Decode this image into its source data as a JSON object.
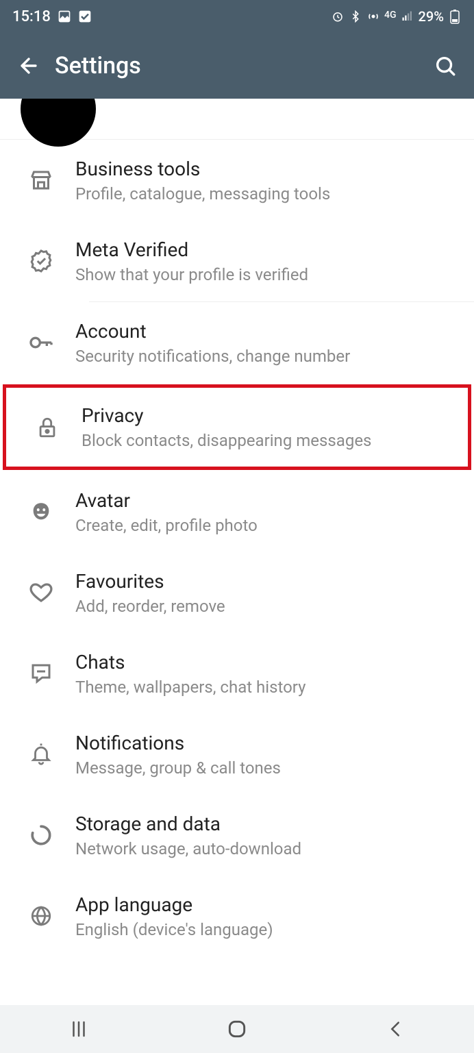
{
  "status": {
    "time": "15:18",
    "battery_text": "29%",
    "network_label": "4G"
  },
  "header": {
    "title": "Settings"
  },
  "settings": [
    {
      "key": "business",
      "title": "Business tools",
      "subtitle": "Profile, catalogue, messaging tools"
    },
    {
      "key": "meta",
      "title": "Meta Verified",
      "subtitle": "Show that your profile is verified"
    },
    {
      "key": "account",
      "title": "Account",
      "subtitle": "Security notifications, change number"
    },
    {
      "key": "privacy",
      "title": "Privacy",
      "subtitle": "Block contacts, disappearing messages"
    },
    {
      "key": "avatar",
      "title": "Avatar",
      "subtitle": "Create, edit, profile photo"
    },
    {
      "key": "favourites",
      "title": "Favourites",
      "subtitle": "Add, reorder, remove"
    },
    {
      "key": "chats",
      "title": "Chats",
      "subtitle": "Theme, wallpapers, chat history"
    },
    {
      "key": "notifications",
      "title": "Notifications",
      "subtitle": "Message, group & call tones"
    },
    {
      "key": "storage",
      "title": "Storage and data",
      "subtitle": "Network usage, auto-download"
    },
    {
      "key": "language",
      "title": "App language",
      "subtitle": "English (device's language)"
    }
  ]
}
